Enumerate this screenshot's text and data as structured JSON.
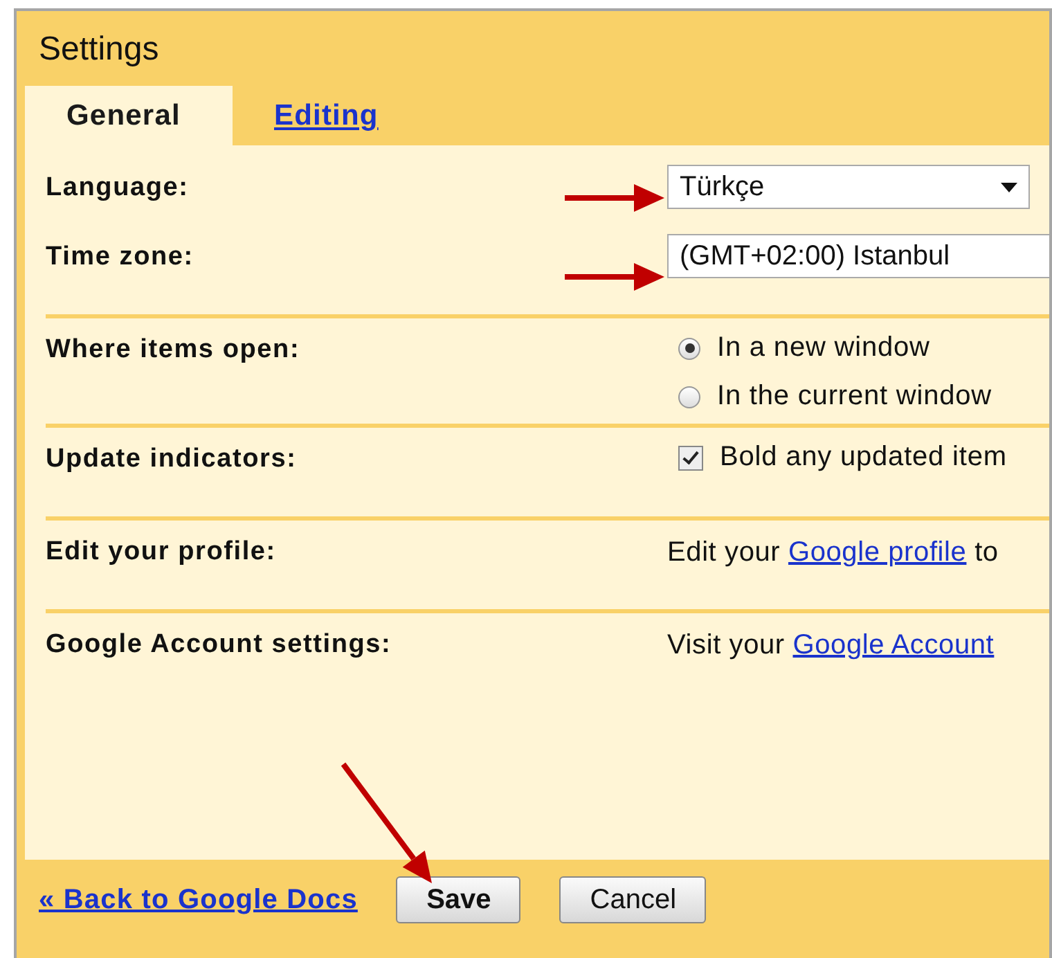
{
  "window": {
    "title": "Settings"
  },
  "tabs": [
    {
      "label": "General",
      "selected": true
    },
    {
      "label": "Editing",
      "selected": false
    }
  ],
  "sections": [
    {
      "rows": [
        {
          "label": "Language:",
          "kind": "select",
          "value": "Türkçe"
        },
        {
          "label": "Time zone:",
          "kind": "field",
          "value": "(GMT+02:00) Istanbul"
        }
      ]
    },
    {
      "rows": [
        {
          "label": "Where items open:",
          "kind": "radio",
          "options": [
            {
              "label": "In a new window",
              "selected": true
            },
            {
              "label": "In the current window",
              "selected": false
            }
          ]
        }
      ]
    },
    {
      "rows": [
        {
          "label": "Update indicators:",
          "kind": "checkbox",
          "text": "Bold any updated item",
          "checked": true
        }
      ]
    },
    {
      "rows": [
        {
          "label": "Edit your profile:",
          "kind": "text",
          "parts": [
            {
              "text": "Edit your ",
              "link": false
            },
            {
              "text": "Google profile",
              "link": true
            },
            {
              "text": " to",
              "link": false
            }
          ]
        }
      ]
    },
    {
      "rows": [
        {
          "label": "Google Account settings:",
          "kind": "text",
          "parts": [
            {
              "text": "Visit your ",
              "link": false
            },
            {
              "text": "Google Account",
              "link": true
            }
          ]
        }
      ]
    }
  ],
  "footer": {
    "back_link": "« Back to Google Docs",
    "buttons": [
      {
        "label": "Save",
        "primary": true
      },
      {
        "label": "Cancel",
        "primary": false
      }
    ]
  }
}
